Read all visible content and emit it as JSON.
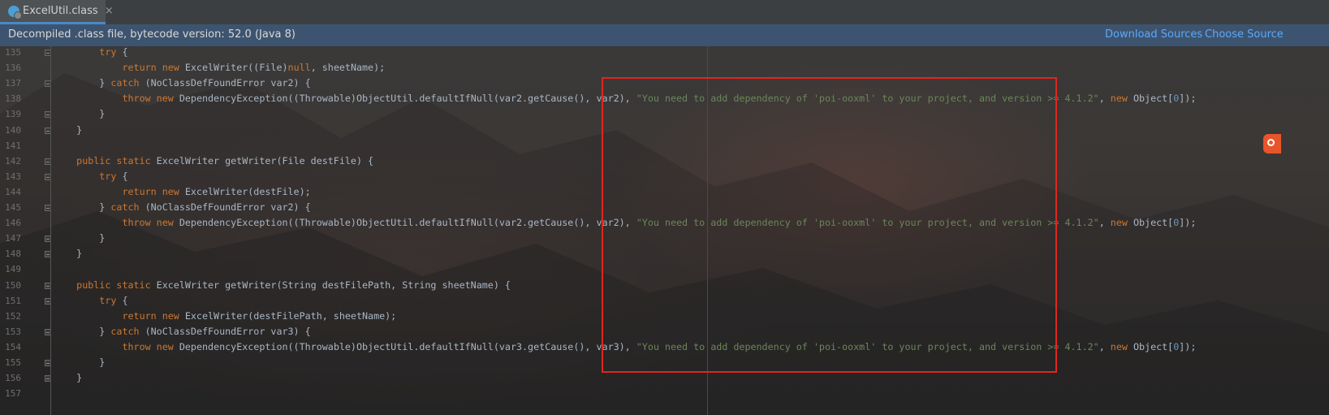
{
  "tab": {
    "title": "ExcelUtil.class",
    "close": "×",
    "icon": "class-file-icon"
  },
  "banner": {
    "text": "Decompiled .class file, bytecode version: 52.0 (Java 8)",
    "download_sources": "Download Sources",
    "choose_sources": "Choose Source"
  },
  "colors": {
    "keyword": "#cc7832",
    "string": "#6a8759",
    "number": "#6897bb",
    "text": "#a9b7c6",
    "highlight": "#e0261f"
  },
  "lines": [
    {
      "n": "135",
      "tokens": [
        [
          "t",
          "        "
        ],
        [
          "k",
          "try"
        ],
        [
          "t",
          " {"
        ]
      ]
    },
    {
      "n": "136",
      "tokens": [
        [
          "t",
          "            "
        ],
        [
          "k",
          "return new "
        ],
        [
          "t",
          "ExcelWriter((File)"
        ],
        [
          "k",
          "null"
        ],
        [
          "t",
          ", sheetName);"
        ]
      ]
    },
    {
      "n": "137",
      "tokens": [
        [
          "t",
          "        } "
        ],
        [
          "k",
          "catch "
        ],
        [
          "t",
          "(NoClassDefFoundError var2) {"
        ]
      ]
    },
    {
      "n": "138",
      "tokens": [
        [
          "t",
          "            "
        ],
        [
          "k",
          "throw new "
        ],
        [
          "t",
          "DependencyException((Throwable)ObjectUtil.defaultIfNull(var2.getCause(), var2), "
        ],
        [
          "s",
          "\"You need to add dependency of 'poi-ooxml' to your project, and version >= 4.1.2\""
        ],
        [
          "t",
          ", "
        ],
        [
          "k",
          "new "
        ],
        [
          "t",
          "Object["
        ],
        [
          "n",
          "0"
        ],
        [
          "t",
          "]);"
        ]
      ]
    },
    {
      "n": "139",
      "tokens": [
        [
          "t",
          "        }"
        ]
      ]
    },
    {
      "n": "140",
      "tokens": [
        [
          "t",
          "    }"
        ]
      ]
    },
    {
      "n": "141",
      "tokens": []
    },
    {
      "n": "142",
      "tokens": [
        [
          "t",
          "    "
        ],
        [
          "k",
          "public static "
        ],
        [
          "t",
          "ExcelWriter getWriter(File destFile) {"
        ]
      ]
    },
    {
      "n": "143",
      "tokens": [
        [
          "t",
          "        "
        ],
        [
          "k",
          "try"
        ],
        [
          "t",
          " {"
        ]
      ]
    },
    {
      "n": "144",
      "tokens": [
        [
          "t",
          "            "
        ],
        [
          "k",
          "return new "
        ],
        [
          "t",
          "ExcelWriter(destFile);"
        ]
      ]
    },
    {
      "n": "145",
      "tokens": [
        [
          "t",
          "        } "
        ],
        [
          "k",
          "catch "
        ],
        [
          "t",
          "(NoClassDefFoundError var2) {"
        ]
      ]
    },
    {
      "n": "146",
      "tokens": [
        [
          "t",
          "            "
        ],
        [
          "k",
          "throw new "
        ],
        [
          "t",
          "DependencyException((Throwable)ObjectUtil.defaultIfNull(var2.getCause(), var2), "
        ],
        [
          "s",
          "\"You need to add dependency of 'poi-ooxml' to your project, and version >= 4.1.2\""
        ],
        [
          "t",
          ", "
        ],
        [
          "k",
          "new "
        ],
        [
          "t",
          "Object["
        ],
        [
          "n",
          "0"
        ],
        [
          "t",
          "]);"
        ]
      ]
    },
    {
      "n": "147",
      "tokens": [
        [
          "t",
          "        }"
        ]
      ]
    },
    {
      "n": "148",
      "tokens": [
        [
          "t",
          "    }"
        ]
      ]
    },
    {
      "n": "149",
      "tokens": []
    },
    {
      "n": "150",
      "tokens": [
        [
          "t",
          "    "
        ],
        [
          "k",
          "public static "
        ],
        [
          "t",
          "ExcelWriter getWriter(String destFilePath, String sheetName) {"
        ]
      ]
    },
    {
      "n": "151",
      "tokens": [
        [
          "t",
          "        "
        ],
        [
          "k",
          "try"
        ],
        [
          "t",
          " {"
        ]
      ]
    },
    {
      "n": "152",
      "tokens": [
        [
          "t",
          "            "
        ],
        [
          "k",
          "return new "
        ],
        [
          "t",
          "ExcelWriter(destFilePath, sheetName);"
        ]
      ]
    },
    {
      "n": "153",
      "tokens": [
        [
          "t",
          "        } "
        ],
        [
          "k",
          "catch "
        ],
        [
          "t",
          "(NoClassDefFoundError var3) {"
        ]
      ]
    },
    {
      "n": "154",
      "tokens": [
        [
          "t",
          "            "
        ],
        [
          "k",
          "throw new "
        ],
        [
          "t",
          "DependencyException((Throwable)ObjectUtil.defaultIfNull(var3.getCause(), var3), "
        ],
        [
          "s",
          "\"You need to add dependency of 'poi-ooxml' to your project, and version >= 4.1.2\""
        ],
        [
          "t",
          ", "
        ],
        [
          "k",
          "new "
        ],
        [
          "t",
          "Object["
        ],
        [
          "n",
          "0"
        ],
        [
          "t",
          "]);"
        ]
      ]
    },
    {
      "n": "155",
      "tokens": [
        [
          "t",
          "        }"
        ]
      ]
    },
    {
      "n": "156",
      "tokens": [
        [
          "t",
          "    }"
        ]
      ]
    },
    {
      "n": "157",
      "tokens": []
    }
  ]
}
